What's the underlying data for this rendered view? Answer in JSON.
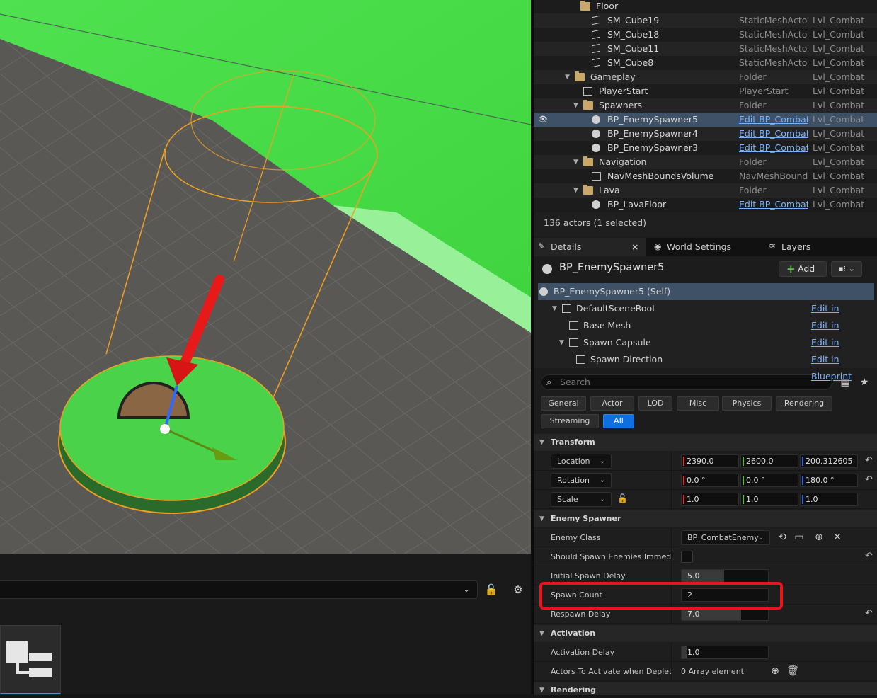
{
  "outliner": {
    "rows": [
      {
        "name": "Floor",
        "type": "",
        "level": "",
        "kind": "folder",
        "indent": 66,
        "arrow": false
      },
      {
        "name": "SM_Cube19",
        "type": "StaticMeshActor",
        "level": "Lvl_Combat",
        "kind": "cube",
        "indent": 82
      },
      {
        "name": "SM_Cube18",
        "type": "StaticMeshActor",
        "level": "Lvl_Combat",
        "kind": "cube",
        "indent": 82
      },
      {
        "name": "SM_Cube11",
        "type": "StaticMeshActor",
        "level": "Lvl_Combat",
        "kind": "cube",
        "indent": 82
      },
      {
        "name": "SM_Cube8",
        "type": "StaticMeshActor",
        "level": "Lvl_Combat",
        "kind": "cube",
        "indent": 82
      },
      {
        "name": "Gameplay",
        "type": "Folder",
        "level": "Lvl_Combat",
        "kind": "folder",
        "indent": 58,
        "arrow": true
      },
      {
        "name": "PlayerStart",
        "type": "PlayerStart",
        "level": "Lvl_Combat",
        "kind": "gen",
        "indent": 70
      },
      {
        "name": "Spawners",
        "type": "Folder",
        "level": "Lvl_Combat",
        "kind": "folder",
        "indent": 70,
        "arrow": true
      },
      {
        "name": "BP_EnemySpawner5",
        "type": "Edit BP_Combat",
        "level": "Lvl_Combat",
        "kind": "bp",
        "indent": 82,
        "link": true,
        "selected": true
      },
      {
        "name": "BP_EnemySpawner4",
        "type": "Edit BP_Combat",
        "level": "Lvl_Combat",
        "kind": "bp",
        "indent": 82,
        "link": true
      },
      {
        "name": "BP_EnemySpawner3",
        "type": "Edit BP_Combat",
        "level": "Lvl_Combat",
        "kind": "bp",
        "indent": 82,
        "link": true
      },
      {
        "name": "Navigation",
        "type": "Folder",
        "level": "Lvl_Combat",
        "kind": "folder",
        "indent": 70,
        "arrow": true
      },
      {
        "name": "NavMeshBoundsVolume",
        "type": "NavMeshBounds",
        "level": "Lvl_Combat",
        "kind": "gen",
        "indent": 82
      },
      {
        "name": "Lava",
        "type": "Folder",
        "level": "Lvl_Combat",
        "kind": "folder",
        "indent": 70,
        "arrow": true
      },
      {
        "name": "BP_LavaFloor",
        "type": "Edit BP_Combat",
        "level": "Lvl_Combat",
        "kind": "bp",
        "indent": 82,
        "link": true
      }
    ],
    "status": "136 actors (1 selected)"
  },
  "tabs": {
    "details": "Details",
    "world_settings": "World Settings",
    "layers": "Layers",
    "close": "×"
  },
  "details": {
    "actor_name": "BP_EnemySpawner5",
    "add_label": "Add",
    "components": [
      {
        "name": "BP_EnemySpawner5 (Self)",
        "indent": 28,
        "selected": true,
        "edit": ""
      },
      {
        "name": "DefaultSceneRoot",
        "indent": 60,
        "arrow": true,
        "edit": "Edit in Blueprint"
      },
      {
        "name": "Base Mesh",
        "indent": 70,
        "edit": "Edit in Blueprint"
      },
      {
        "name": "Spawn Capsule",
        "indent": 70,
        "arrow": true,
        "edit": "Edit in Blueprint"
      },
      {
        "name": "Spawn Direction",
        "indent": 80,
        "edit": "Edit in Blueprint"
      }
    ],
    "search_placeholder": "Search",
    "filters": [
      "General",
      "Actor",
      "LOD",
      "Misc",
      "Physics",
      "Rendering",
      "Streaming",
      "All"
    ],
    "active_filter": "All",
    "transform": {
      "title": "Transform",
      "location_label": "Location",
      "location": [
        "2390.0",
        "2600.0",
        "200.312605"
      ],
      "rotation_label": "Rotation",
      "rotation": [
        "0.0 °",
        "0.0 °",
        "180.0 °"
      ],
      "scale_label": "Scale",
      "scale": [
        "1.0",
        "1.0",
        "1.0"
      ]
    },
    "enemy_spawner": {
      "title": "Enemy Spawner",
      "enemy_class_label": "Enemy Class",
      "enemy_class": "BP_CombatEnemy",
      "should_spawn_label": "Should Spawn Enemies Immedi...",
      "initial_delay_label": "Initial Spawn Delay",
      "initial_delay": "5.0",
      "spawn_count_label": "Spawn Count",
      "spawn_count": "2",
      "respawn_delay_label": "Respawn Delay",
      "respawn_delay": "7.0"
    },
    "activation": {
      "title": "Activation",
      "delay_label": "Activation Delay",
      "delay": "1.0",
      "actors_label": "Actors To Activate when Depleted",
      "actors_value": "0 Array element"
    },
    "rendering_title": "Rendering"
  },
  "colors": {
    "accent": "#0e6fe0",
    "selection": "#3e5166",
    "highlight": "#e8141e",
    "link": "#7cb3ff"
  }
}
